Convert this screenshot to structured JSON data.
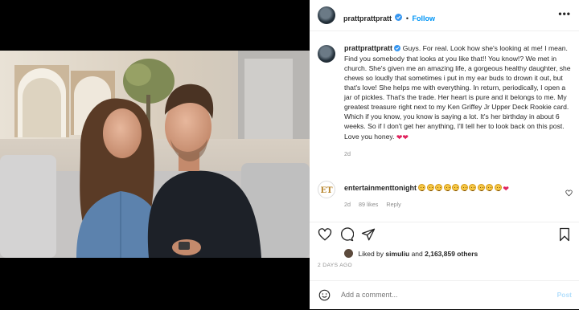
{
  "post": {
    "username": "prattprattpratt",
    "follow_label": "Follow",
    "separator": "•",
    "more_label": "•••"
  },
  "caption": {
    "username": "prattprattpratt",
    "text": "Guys. For real. Look how she's looking at me! I mean. Find you somebody that looks at you like that!! You know!? We met in church. She's given me an amazing life, a gorgeous healthy daughter, she chews so loudly that sometimes i put in my ear buds to drown it out, but that's love! She helps me with everything. In return, periodically, I open a jar of pickles. That's the trade. Her heart is pure and it belongs to me. My greatest treasure right next to my Ken Griffey Jr Upper Deck Rookie card. Which if you know, you know is saying a lot. It's her birthday in about 6 weeks. So if I don't get her anything, I'll tell her to look back on this post. Love you honey.",
    "time": "2d"
  },
  "comment": {
    "username": "entertainmenttonight",
    "logo_text": "ET",
    "emoji_count": 10,
    "time": "2d",
    "likes": "89 likes",
    "reply_label": "Reply"
  },
  "likes": {
    "prefix": "Liked by",
    "user": "simuliu",
    "conjunction": "and",
    "count": "2,163,859 others"
  },
  "date_label": "2 DAYS AGO",
  "add_comment": {
    "placeholder": "Add a comment...",
    "post_label": "Post"
  },
  "colors": {
    "accent": "#0095f6",
    "verified": "#3897f0",
    "heart": "#e0245e",
    "muted": "#8e8e8e"
  },
  "icons": [
    "verified-badge-icon",
    "heart-icon",
    "comment-icon",
    "share-icon",
    "bookmark-icon",
    "smile-icon",
    "more-icon"
  ]
}
